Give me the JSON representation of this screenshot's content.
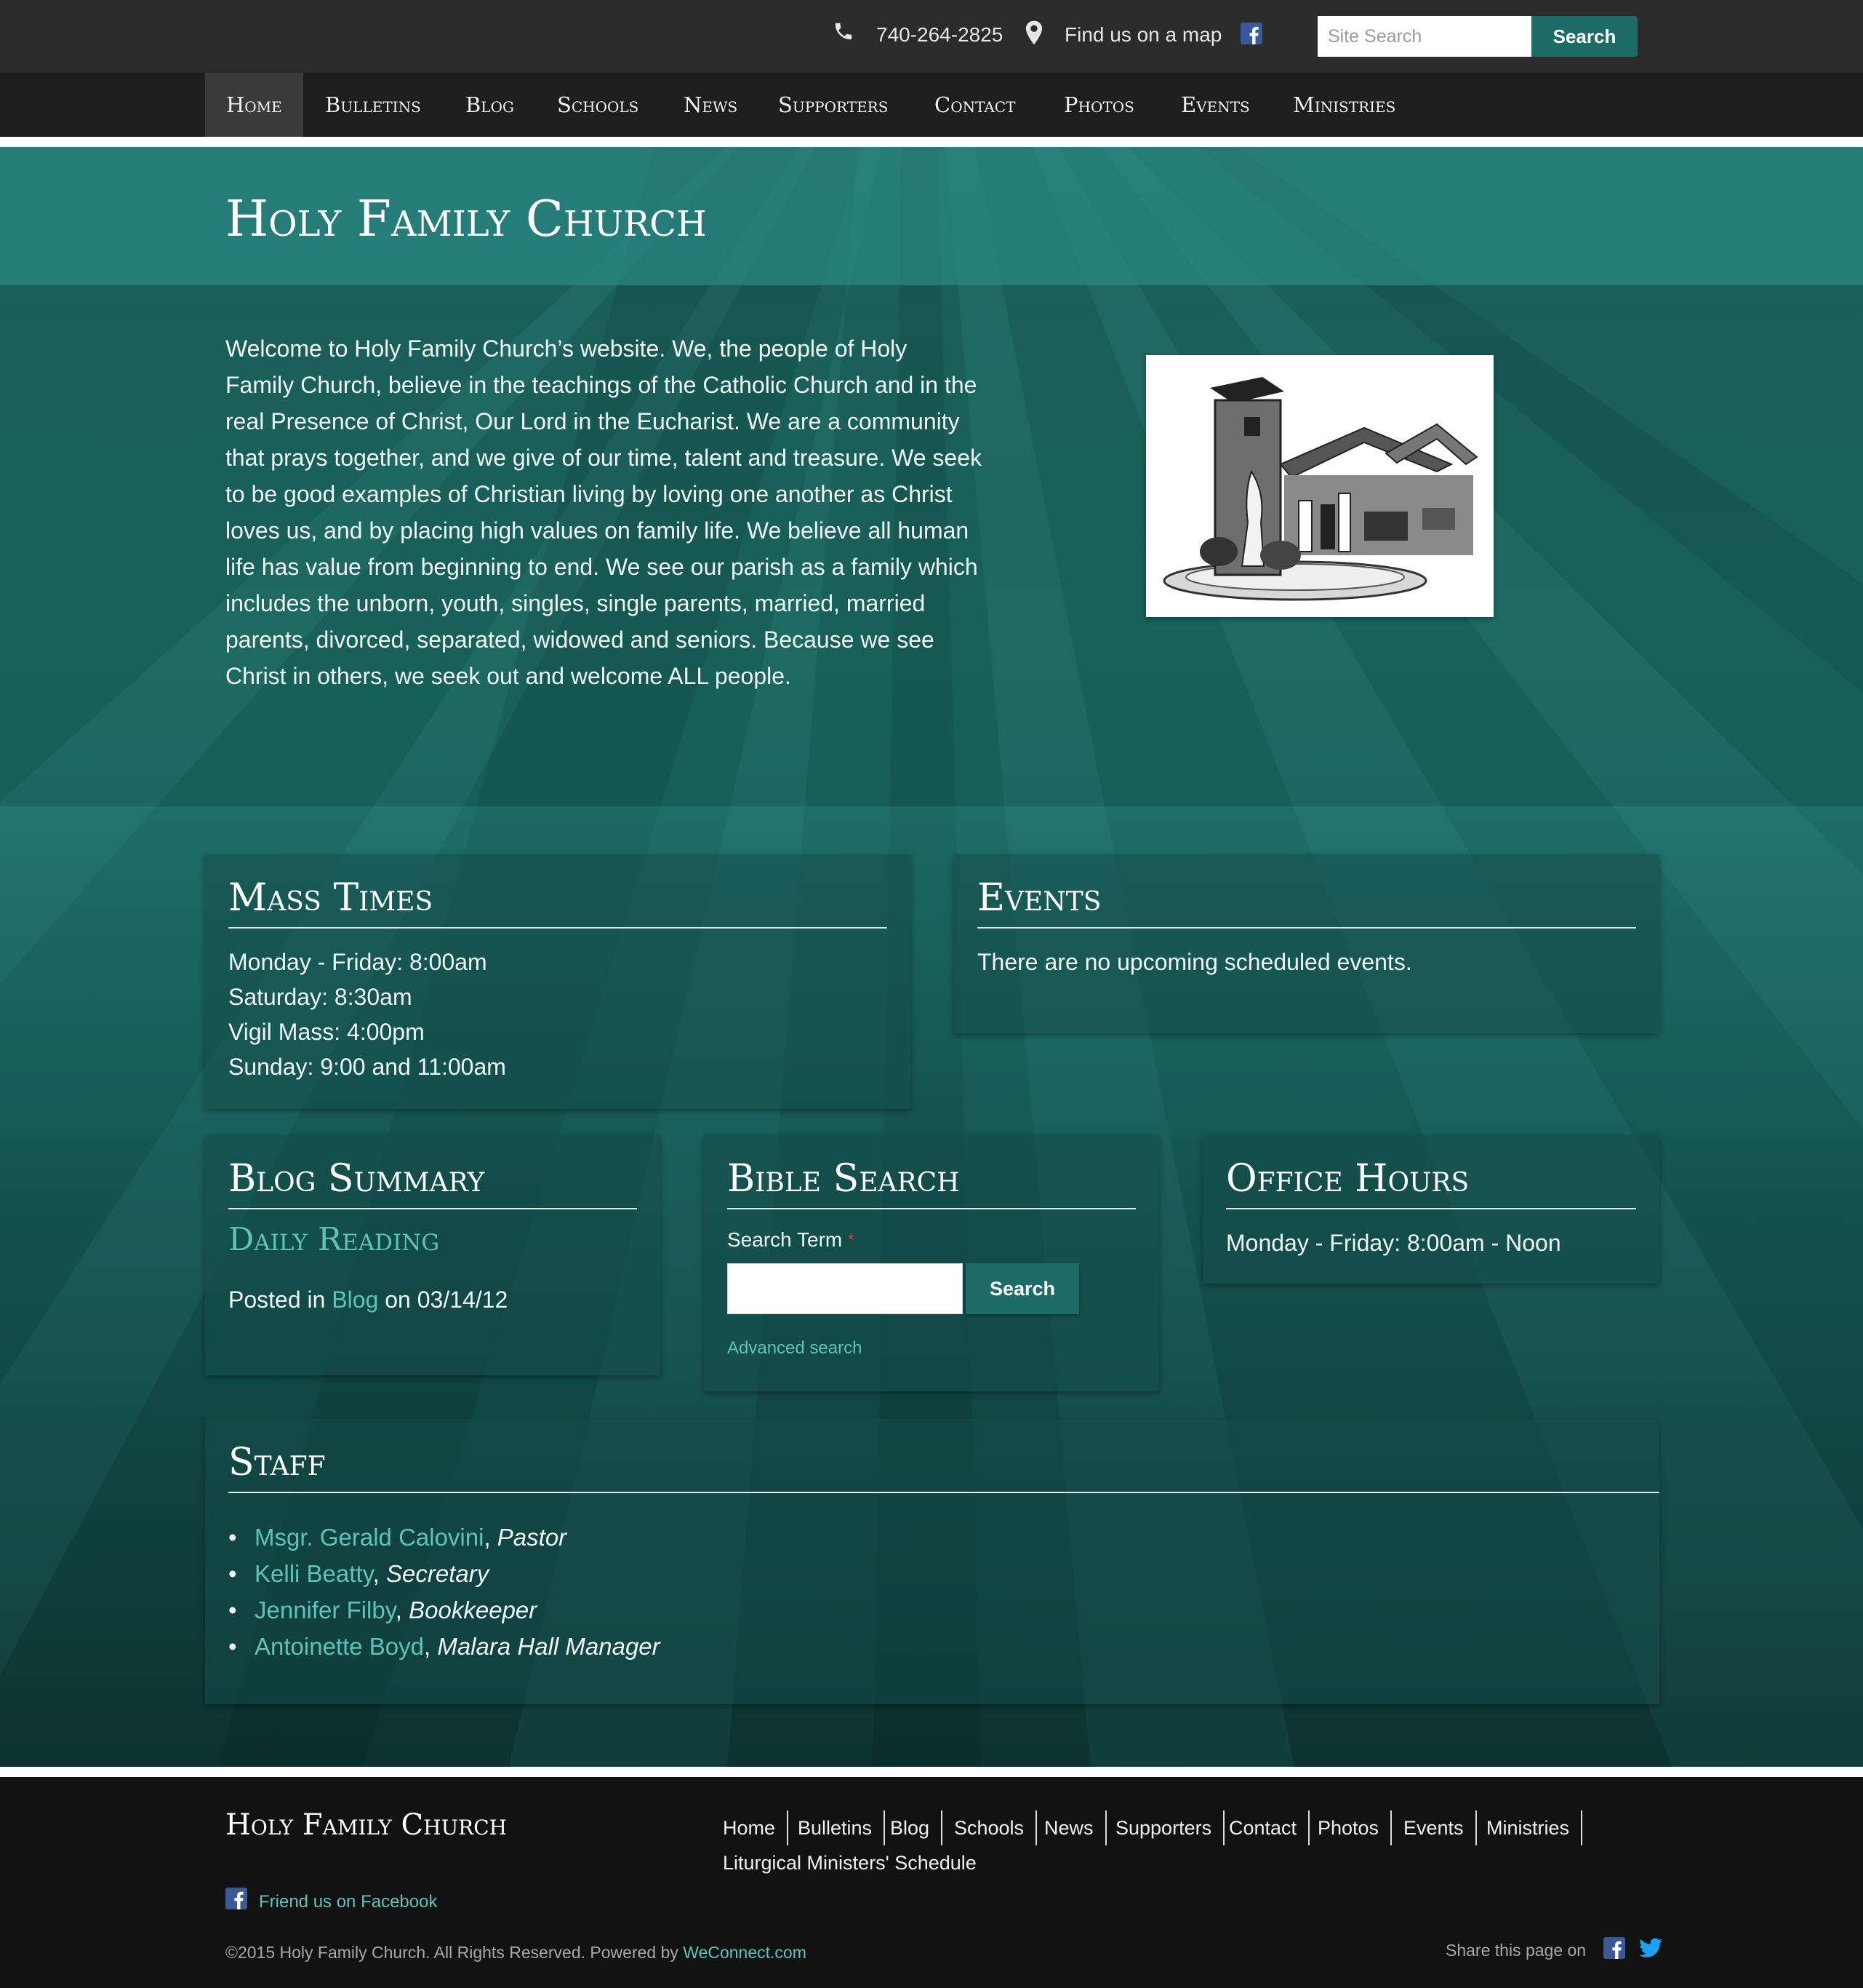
{
  "topbar": {
    "phone_icon": "phone-icon",
    "phone": "740-264-2825",
    "map_icon": "map-pin-icon",
    "map_link": "Find us on a map",
    "facebook_icon": "facebook-icon",
    "search_placeholder": "Site Search",
    "search_button": "Search"
  },
  "nav": {
    "items": [
      "Home",
      "Bulletins",
      "Blog",
      "Schools",
      "News",
      "Supporters",
      "Contact",
      "Photos",
      "Events",
      "Ministries"
    ],
    "active": "Home"
  },
  "hero": {
    "title": "Holy Family Church",
    "welcome": "Welcome to Holy Family Church’s website. We, the people of Holy Family Church, believe in the teachings of the Catholic Church and in the real Presence of Christ, Our Lord in the Eucharist. We are a community that prays together, and we give of our time, talent and treasure. We seek to be good examples of Christian living by loving one another as Christ loves us, and by placing high values on family life. We believe all human life has value from beginning to end. We see our parish as a family which includes the unborn, youth, singles, single parents, married, married parents, divorced, separated, widowed and seniors. Because we see Christ in others, we seek out and welcome ALL people."
  },
  "mass_times": {
    "title": "Mass Times",
    "lines": [
      "Monday - Friday: 8:00am",
      "Saturday: 8:30am",
      "Vigil Mass: 4:00pm",
      "Sunday: 9:00 and 11:00am"
    ]
  },
  "events": {
    "title": "Events",
    "text": "There are no upcoming scheduled events."
  },
  "blog_summary": {
    "title": "Blog Summary",
    "post_title": "Daily Reading",
    "posted_in": "Posted in",
    "category": "Blog",
    "on": "on",
    "date": "03/14/12"
  },
  "bible_search": {
    "title": "Bible Search",
    "label": "Search Term",
    "required_mark": "*",
    "button": "Search",
    "advanced": "Advanced search"
  },
  "office_hours": {
    "title": "Office Hours",
    "text": "Monday - Friday: 8:00am - Noon"
  },
  "staff": {
    "title": "Staff",
    "members": [
      {
        "name": "Msgr. Gerald Calovini",
        "role": "Pastor"
      },
      {
        "name": "Kelli Beatty",
        "role": "Secretary"
      },
      {
        "name": "Jennifer Filby",
        "role": "Bookkeeper"
      },
      {
        "name": "Antoinette Boyd",
        "role": "Malara Hall Manager"
      }
    ]
  },
  "footer": {
    "title": "Holy Family Church",
    "nav": [
      "Home",
      "Bulletins",
      "Blog",
      "Schools",
      "News",
      "Supporters",
      "Contact",
      "Photos",
      "Events",
      "Ministries"
    ],
    "nav_second_line": "Liturgical Ministers' Schedule",
    "facebook_text": "Friend us on Facebook",
    "copyright": "©2015 Holy Family Church. All Rights Reserved. Powered by",
    "powered_link": "WeConnect.com",
    "share_text": "Share this page on",
    "share_icons": [
      "facebook-icon",
      "twitter-icon"
    ]
  },
  "colors": {
    "teal_dark": "#176059",
    "teal_band": "#2f8f8a",
    "link": "#5fc3b9",
    "button": "#1c6b66",
    "topbar": "#2b2b2b",
    "nav": "#1e1e1e",
    "footer": "#121212",
    "facebook_blue": "#3b5998",
    "twitter_blue": "#1da1f2"
  }
}
